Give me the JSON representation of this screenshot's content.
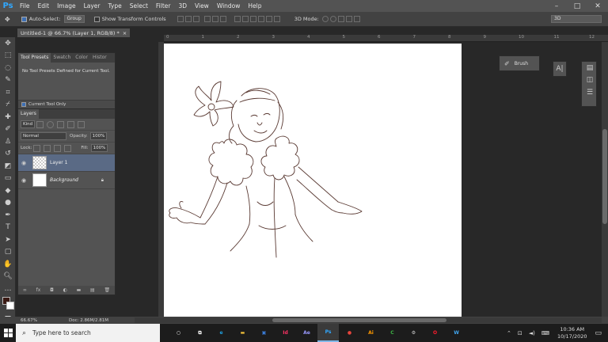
{
  "app": {
    "logo": "Ps",
    "accent": "#31a8ff"
  },
  "menu": [
    "File",
    "Edit",
    "Image",
    "Layer",
    "Type",
    "Select",
    "Filter",
    "3D",
    "View",
    "Window",
    "Help"
  ],
  "window_controls": {
    "minimize": "–",
    "maximize": "□",
    "close": "✕"
  },
  "options": {
    "auto_select_label": "Auto-Select:",
    "auto_select_value": "Group",
    "transform_label": "Show Transform Controls",
    "mode_3d_label": "3D Mode:",
    "workspace_value": "3D"
  },
  "document": {
    "tab_title": "Untitled-1 @ 66.7% (Layer 1, RGB/8) *",
    "close_glyph": "×",
    "ruler_ticks": [
      "0",
      "1",
      "2",
      "3",
      "4",
      "5",
      "6",
      "7",
      "8",
      "9",
      "10",
      "11",
      "12"
    ]
  },
  "presets_panel": {
    "tabs": [
      "Tool Presets",
      "Swatch",
      "Color",
      "Histor"
    ],
    "message": "No Tool Presets Defined for Current Tool.",
    "current_tool_only": "Current Tool Only"
  },
  "layers_panel": {
    "title": "Layers",
    "filter_kind": "Kind",
    "blend_mode": "Normal",
    "opacity_label": "Opacity:",
    "opacity_value": "100%",
    "lock_label": "Lock:",
    "fill_label": "Fill:",
    "fill_value": "100%",
    "layers": [
      {
        "name": "Layer 1",
        "selected": true
      },
      {
        "name": "Background",
        "selected": false
      }
    ],
    "footer_fx": "fx"
  },
  "right_panels": {
    "brush_label": "Brush",
    "char_glyph": "A|"
  },
  "status": {
    "zoom": "66.67%",
    "doc": "Doc: 2.86M/2.81M"
  },
  "taskbar": {
    "search_placeholder": "Type here to search",
    "apps": [
      {
        "name": "cortana",
        "label": "○",
        "color": "#ffffff"
      },
      {
        "name": "task-view",
        "label": "⧉",
        "color": "#ffffff"
      },
      {
        "name": "edge",
        "label": "e",
        "color": "#1fa0e0"
      },
      {
        "name": "file-explorer",
        "label": "▬",
        "color": "#f3c13a"
      },
      {
        "name": "store",
        "label": "▣",
        "color": "#3a7bd5"
      },
      {
        "name": "indesign",
        "label": "Id",
        "color": "#ff3366"
      },
      {
        "name": "after-effects",
        "label": "Ae",
        "color": "#9999ff"
      },
      {
        "name": "photoshop",
        "label": "Ps",
        "color": "#31a8ff"
      },
      {
        "name": "chrome",
        "label": "●",
        "color": "#e8453c"
      },
      {
        "name": "illustrator",
        "label": "Ai",
        "color": "#ff9a00"
      },
      {
        "name": "camtasia",
        "label": "C",
        "color": "#3cb043"
      },
      {
        "name": "settings",
        "label": "⚙",
        "color": "#cfcfcf"
      },
      {
        "name": "opera",
        "label": "O",
        "color": "#ff1b2d"
      },
      {
        "name": "word-like",
        "label": "W",
        "color": "#41a5ee"
      }
    ],
    "clock_time": "10:36 AM",
    "clock_date": "10/17/2020"
  }
}
